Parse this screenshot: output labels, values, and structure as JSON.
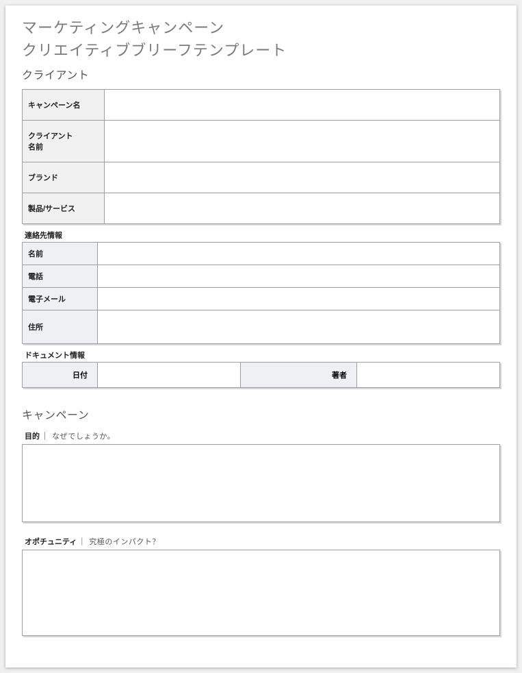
{
  "title_line1": "マーケティングキャンペーン",
  "title_line2": "クリエイティブブリーフテンプレート",
  "client": {
    "heading": "クライアント",
    "rows": {
      "campaign_name": {
        "label": "キャンペーン名",
        "value": ""
      },
      "client_name": {
        "label": "クライアント\n名前",
        "value": ""
      },
      "brand": {
        "label": "ブランド",
        "value": ""
      },
      "product": {
        "label": "製品/サービス",
        "value": ""
      }
    }
  },
  "contact": {
    "heading": "連絡先情報",
    "rows": {
      "name": {
        "label": "名前",
        "value": ""
      },
      "phone": {
        "label": "電話",
        "value": ""
      },
      "email": {
        "label": "電子メール",
        "value": ""
      },
      "address": {
        "label": "住所",
        "value": ""
      }
    }
  },
  "document": {
    "heading": "ドキュメント情報",
    "date": {
      "label": "日付",
      "value": ""
    },
    "author": {
      "label": "著者",
      "value": ""
    }
  },
  "campaign": {
    "heading": "キャンペーン",
    "objective": {
      "label": "目的",
      "hint": "なぜでしょうか。",
      "value": ""
    },
    "opportunity": {
      "label": "オポチュニティ",
      "hint": "究極のインパクト？",
      "value": ""
    }
  },
  "sep": "｜"
}
